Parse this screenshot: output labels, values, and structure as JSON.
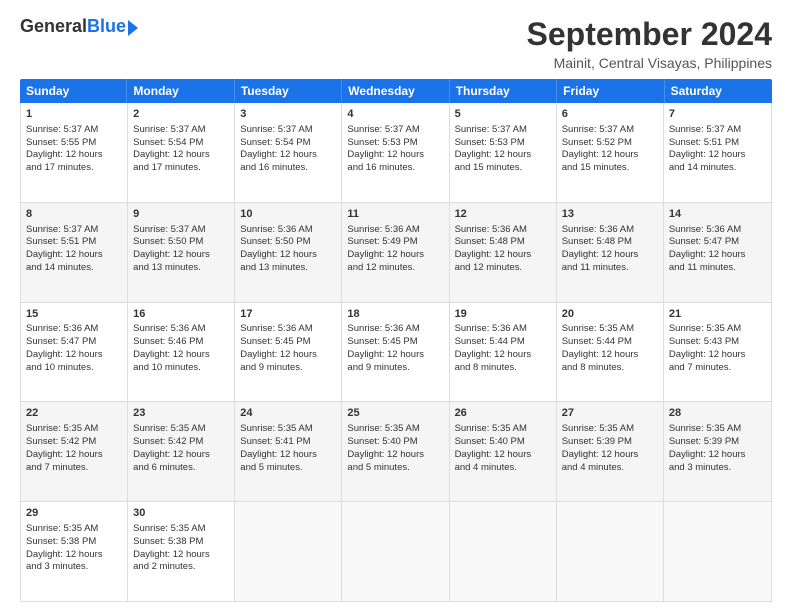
{
  "logo": {
    "general": "General",
    "blue": "Blue"
  },
  "title": "September 2024",
  "subtitle": "Mainit, Central Visayas, Philippines",
  "headers": [
    "Sunday",
    "Monday",
    "Tuesday",
    "Wednesday",
    "Thursday",
    "Friday",
    "Saturday"
  ],
  "rows": [
    [
      {
        "day": "",
        "empty": true,
        "lines": []
      },
      {
        "day": "2",
        "lines": [
          "Sunrise: 5:37 AM",
          "Sunset: 5:54 PM",
          "Daylight: 12 hours",
          "and 17 minutes."
        ]
      },
      {
        "day": "3",
        "lines": [
          "Sunrise: 5:37 AM",
          "Sunset: 5:54 PM",
          "Daylight: 12 hours",
          "and 16 minutes."
        ]
      },
      {
        "day": "4",
        "lines": [
          "Sunrise: 5:37 AM",
          "Sunset: 5:53 PM",
          "Daylight: 12 hours",
          "and 16 minutes."
        ]
      },
      {
        "day": "5",
        "lines": [
          "Sunrise: 5:37 AM",
          "Sunset: 5:53 PM",
          "Daylight: 12 hours",
          "and 15 minutes."
        ]
      },
      {
        "day": "6",
        "lines": [
          "Sunrise: 5:37 AM",
          "Sunset: 5:52 PM",
          "Daylight: 12 hours",
          "and 15 minutes."
        ]
      },
      {
        "day": "7",
        "lines": [
          "Sunrise: 5:37 AM",
          "Sunset: 5:51 PM",
          "Daylight: 12 hours",
          "and 14 minutes."
        ]
      }
    ],
    [
      {
        "day": "8",
        "lines": [
          "Sunrise: 5:37 AM",
          "Sunset: 5:51 PM",
          "Daylight: 12 hours",
          "and 14 minutes."
        ]
      },
      {
        "day": "9",
        "lines": [
          "Sunrise: 5:37 AM",
          "Sunset: 5:50 PM",
          "Daylight: 12 hours",
          "and 13 minutes."
        ]
      },
      {
        "day": "10",
        "lines": [
          "Sunrise: 5:36 AM",
          "Sunset: 5:50 PM",
          "Daylight: 12 hours",
          "and 13 minutes."
        ]
      },
      {
        "day": "11",
        "lines": [
          "Sunrise: 5:36 AM",
          "Sunset: 5:49 PM",
          "Daylight: 12 hours",
          "and 12 minutes."
        ]
      },
      {
        "day": "12",
        "lines": [
          "Sunrise: 5:36 AM",
          "Sunset: 5:48 PM",
          "Daylight: 12 hours",
          "and 12 minutes."
        ]
      },
      {
        "day": "13",
        "lines": [
          "Sunrise: 5:36 AM",
          "Sunset: 5:48 PM",
          "Daylight: 12 hours",
          "and 11 minutes."
        ]
      },
      {
        "day": "14",
        "lines": [
          "Sunrise: 5:36 AM",
          "Sunset: 5:47 PM",
          "Daylight: 12 hours",
          "and 11 minutes."
        ]
      }
    ],
    [
      {
        "day": "15",
        "lines": [
          "Sunrise: 5:36 AM",
          "Sunset: 5:47 PM",
          "Daylight: 12 hours",
          "and 10 minutes."
        ]
      },
      {
        "day": "16",
        "lines": [
          "Sunrise: 5:36 AM",
          "Sunset: 5:46 PM",
          "Daylight: 12 hours",
          "and 10 minutes."
        ]
      },
      {
        "day": "17",
        "lines": [
          "Sunrise: 5:36 AM",
          "Sunset: 5:45 PM",
          "Daylight: 12 hours",
          "and 9 minutes."
        ]
      },
      {
        "day": "18",
        "lines": [
          "Sunrise: 5:36 AM",
          "Sunset: 5:45 PM",
          "Daylight: 12 hours",
          "and 9 minutes."
        ]
      },
      {
        "day": "19",
        "lines": [
          "Sunrise: 5:36 AM",
          "Sunset: 5:44 PM",
          "Daylight: 12 hours",
          "and 8 minutes."
        ]
      },
      {
        "day": "20",
        "lines": [
          "Sunrise: 5:35 AM",
          "Sunset: 5:44 PM",
          "Daylight: 12 hours",
          "and 8 minutes."
        ]
      },
      {
        "day": "21",
        "lines": [
          "Sunrise: 5:35 AM",
          "Sunset: 5:43 PM",
          "Daylight: 12 hours",
          "and 7 minutes."
        ]
      }
    ],
    [
      {
        "day": "22",
        "lines": [
          "Sunrise: 5:35 AM",
          "Sunset: 5:42 PM",
          "Daylight: 12 hours",
          "and 7 minutes."
        ]
      },
      {
        "day": "23",
        "lines": [
          "Sunrise: 5:35 AM",
          "Sunset: 5:42 PM",
          "Daylight: 12 hours",
          "and 6 minutes."
        ]
      },
      {
        "day": "24",
        "lines": [
          "Sunrise: 5:35 AM",
          "Sunset: 5:41 PM",
          "Daylight: 12 hours",
          "and 5 minutes."
        ]
      },
      {
        "day": "25",
        "lines": [
          "Sunrise: 5:35 AM",
          "Sunset: 5:40 PM",
          "Daylight: 12 hours",
          "and 5 minutes."
        ]
      },
      {
        "day": "26",
        "lines": [
          "Sunrise: 5:35 AM",
          "Sunset: 5:40 PM",
          "Daylight: 12 hours",
          "and 4 minutes."
        ]
      },
      {
        "day": "27",
        "lines": [
          "Sunrise: 5:35 AM",
          "Sunset: 5:39 PM",
          "Daylight: 12 hours",
          "and 4 minutes."
        ]
      },
      {
        "day": "28",
        "lines": [
          "Sunrise: 5:35 AM",
          "Sunset: 5:39 PM",
          "Daylight: 12 hours",
          "and 3 minutes."
        ]
      }
    ],
    [
      {
        "day": "29",
        "lines": [
          "Sunrise: 5:35 AM",
          "Sunset: 5:38 PM",
          "Daylight: 12 hours",
          "and 3 minutes."
        ]
      },
      {
        "day": "30",
        "lines": [
          "Sunrise: 5:35 AM",
          "Sunset: 5:38 PM",
          "Daylight: 12 hours",
          "and 2 minutes."
        ]
      },
      {
        "day": "",
        "empty": true,
        "lines": []
      },
      {
        "day": "",
        "empty": true,
        "lines": []
      },
      {
        "day": "",
        "empty": true,
        "lines": []
      },
      {
        "day": "",
        "empty": true,
        "lines": []
      },
      {
        "day": "",
        "empty": true,
        "lines": []
      }
    ]
  ],
  "row0_day1": {
    "day": "1",
    "lines": [
      "Sunrise: 5:37 AM",
      "Sunset: 5:55 PM",
      "Daylight: 12 hours",
      "and 17 minutes."
    ]
  }
}
